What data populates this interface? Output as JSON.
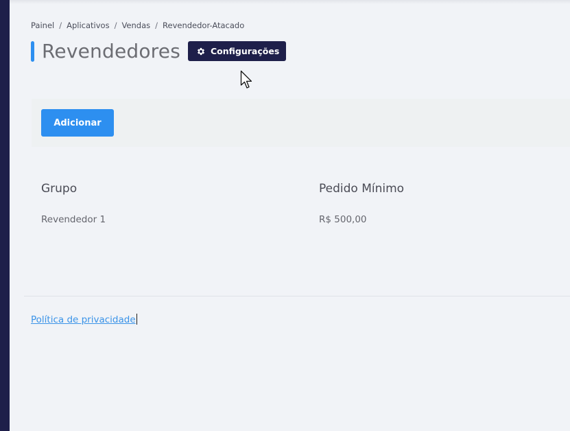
{
  "breadcrumb": {
    "items": [
      "Painel",
      "Aplicativos",
      "Vendas",
      "Revendedor-Atacado"
    ],
    "separator": "/"
  },
  "header": {
    "title": "Revendedores",
    "settings_button": {
      "label": "Configurações",
      "icon": "gear-icon"
    }
  },
  "actions": {
    "add_label": "Adicionar"
  },
  "table": {
    "columns": [
      "Grupo",
      "Pedido Mínimo"
    ],
    "rows": [
      [
        "Revendedor 1",
        "R$ 500,00"
      ]
    ]
  },
  "footer": {
    "privacy_link": "Política de privacidade"
  },
  "colors": {
    "accent": "#2d8ff0",
    "dark": "#1e1f4a",
    "background": "#f1f3f7",
    "link": "#3a93e8"
  }
}
